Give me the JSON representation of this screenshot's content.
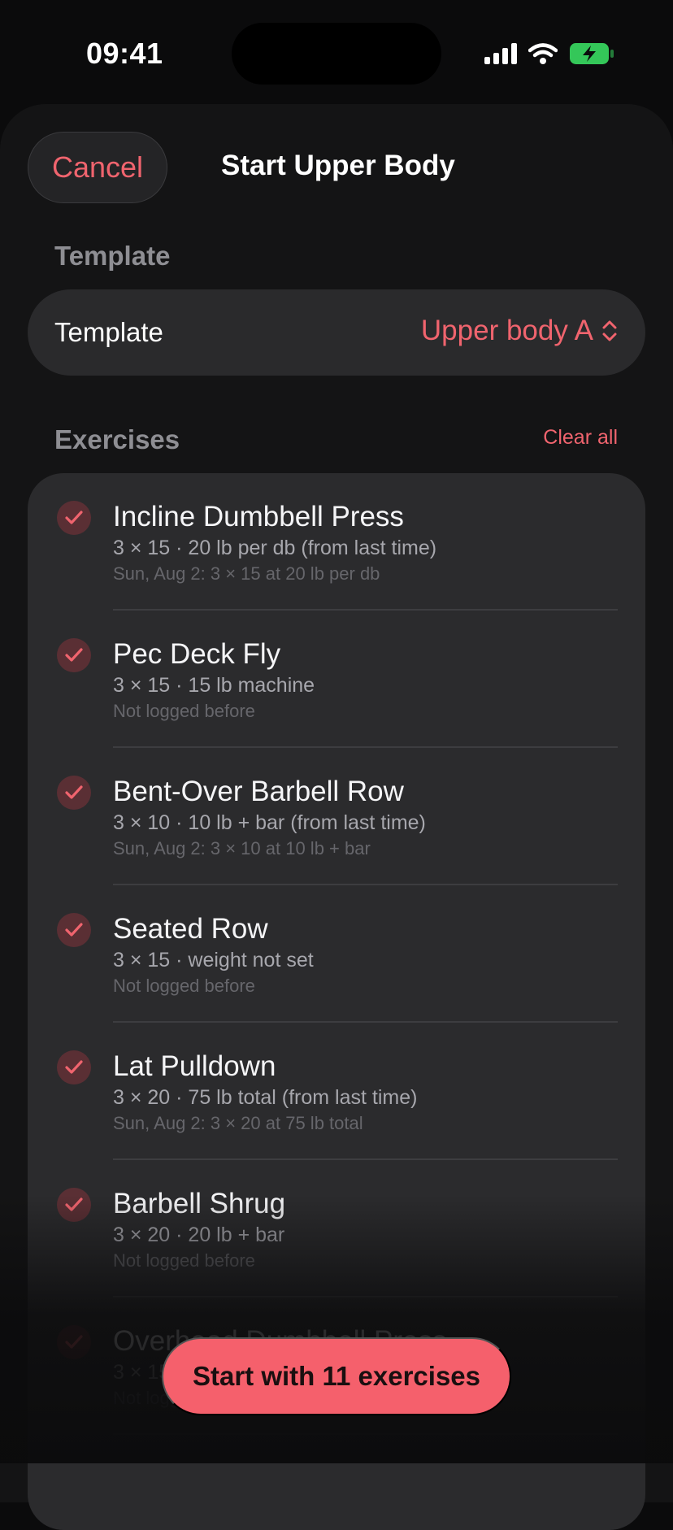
{
  "status": {
    "time": "09:41",
    "icons": [
      "cellular-icon",
      "wifi-icon",
      "battery-charging-icon"
    ]
  },
  "nav": {
    "cancel_label": "Cancel",
    "title": "Start Upper Body"
  },
  "template_section": {
    "header": "Template",
    "row_label": "Template",
    "selected": "Upper body A"
  },
  "exercises_section": {
    "header": "Exercises",
    "clear_all_label": "Clear all",
    "items": [
      {
        "name": "Incline Dumbbell Press",
        "detail": "3 × 15 · 20 lb per db (from last time)",
        "history": "Sun, Aug 2: 3 × 15 at 20 lb per db",
        "checked": true
      },
      {
        "name": "Pec Deck Fly",
        "detail": "3 × 15 · 15 lb machine",
        "history": "Not logged before",
        "checked": true
      },
      {
        "name": "Bent-Over Barbell Row",
        "detail": "3 × 10 · 10 lb + bar (from last time)",
        "history": "Sun, Aug 2: 3 × 10 at 10 lb + bar",
        "checked": true
      },
      {
        "name": "Seated Row",
        "detail": "3 × 15 · weight not set",
        "history": "Not logged before",
        "checked": true
      },
      {
        "name": "Lat Pulldown",
        "detail": "3 × 20 · 75 lb total (from last time)",
        "history": "Sun, Aug 2: 3 × 20 at 75 lb total",
        "checked": true
      },
      {
        "name": "Barbell Shrug",
        "detail": "3 × 20 · 20 lb + bar",
        "history": "Not logged before",
        "checked": true
      },
      {
        "name": "Overhead Dumbbell Press",
        "detail": "3 × 15",
        "history": "Not logged before",
        "checked": true
      }
    ]
  },
  "start_button_label": "Start with 11 exercises",
  "colors": {
    "accent": "#f0646e",
    "button": "#f5606c",
    "background": "#0b0b0c",
    "card": "#2b2b2d"
  }
}
